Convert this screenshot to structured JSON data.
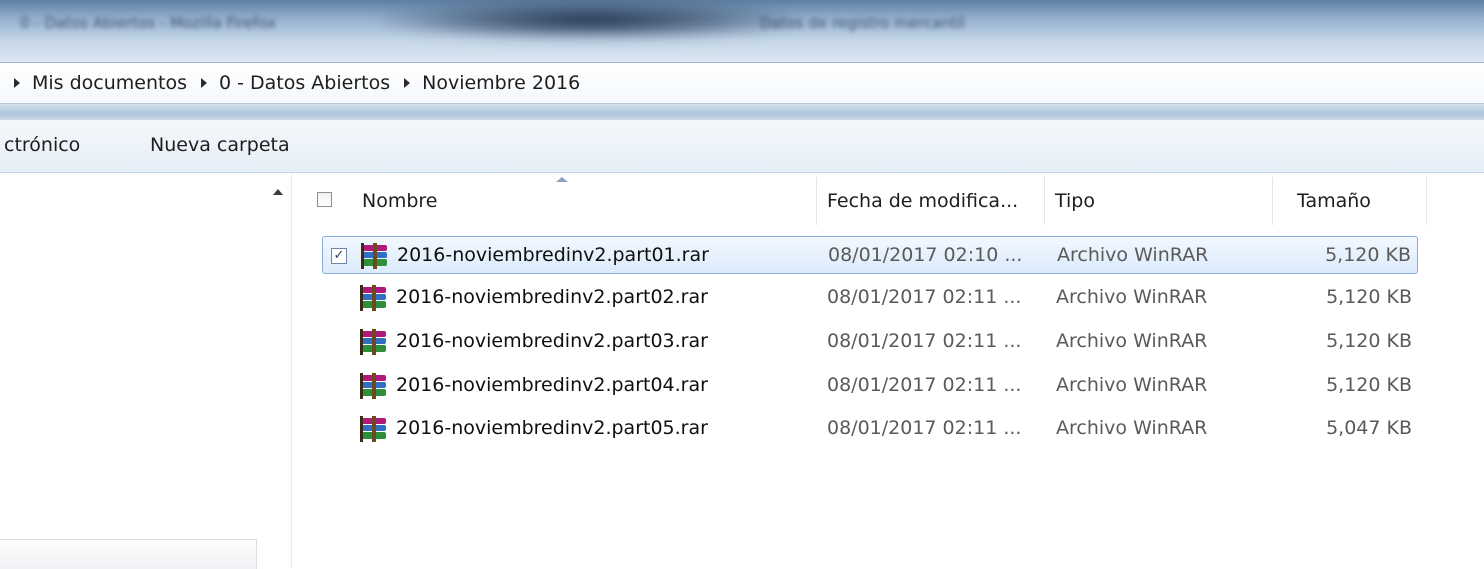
{
  "window": {
    "title": "0 - Datos Abiertos - Mozilla Firefox",
    "secondary_title": "Datos de registro mercantil"
  },
  "address_bar": {
    "breadcrumbs": [
      "Mis documentos",
      "0 - Datos Abiertos",
      "Noviembre 2016"
    ]
  },
  "toolbar": {
    "items": [
      "ctrónico",
      "Nueva carpeta"
    ]
  },
  "columns": {
    "name": "Nombre",
    "date": "Fecha de modifica...",
    "type": "Tipo",
    "size": "Tamaño"
  },
  "files": [
    {
      "name": "2016-noviembredinv2.part01.rar",
      "date": "08/01/2017 02:10 ...",
      "type": "Archivo WinRAR",
      "size": "5,120 KB",
      "selected": true,
      "checked": true,
      "icon": "winrar-archive-icon"
    },
    {
      "name": "2016-noviembredinv2.part02.rar",
      "date": "08/01/2017 02:11 ...",
      "type": "Archivo WinRAR",
      "size": "5,120 KB",
      "selected": false,
      "checked": false,
      "icon": "winrar-archive-icon"
    },
    {
      "name": "2016-noviembredinv2.part03.rar",
      "date": "08/01/2017 02:11 ...",
      "type": "Archivo WinRAR",
      "size": "5,120 KB",
      "selected": false,
      "checked": false,
      "icon": "winrar-archive-icon"
    },
    {
      "name": "2016-noviembredinv2.part04.rar",
      "date": "08/01/2017 02:11 ...",
      "type": "Archivo WinRAR",
      "size": "5,120 KB",
      "selected": false,
      "checked": false,
      "icon": "winrar-archive-icon"
    },
    {
      "name": "2016-noviembredinv2.part05.rar",
      "date": "08/01/2017 02:11 ...",
      "type": "Archivo WinRAR",
      "size": "5,047 KB",
      "selected": false,
      "checked": false,
      "icon": "winrar-archive-icon"
    }
  ],
  "colors": {
    "selection_border": "#84acdd",
    "selection_fill": "#dcebfc",
    "secondary_text": "#5a5a5a"
  }
}
